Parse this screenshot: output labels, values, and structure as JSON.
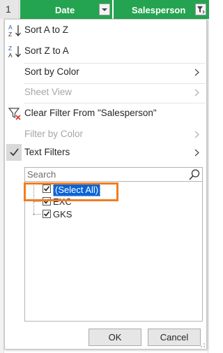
{
  "sheet": {
    "row_number": "1",
    "columns": [
      {
        "title": "Date",
        "filter_state": "dropdown"
      },
      {
        "title": "Salesperson",
        "filter_state": "filtered"
      }
    ],
    "header_color": "#24a450"
  },
  "menu": {
    "items": [
      {
        "label": "Sort A to Z",
        "icon": "sort-a-to-z-icon",
        "enabled": true
      },
      {
        "label": "Sort Z to A",
        "icon": "sort-z-to-a-icon",
        "enabled": true
      },
      {
        "label": "Sort by Color",
        "enabled": true,
        "submenu": true
      },
      {
        "label": "Sheet View",
        "enabled": false,
        "submenu": true
      },
      {
        "label": "Clear Filter From \"Salesperson\"",
        "icon": "clear-filter-icon",
        "enabled": true
      },
      {
        "label": "Filter by Color",
        "enabled": false,
        "submenu": true
      },
      {
        "label": "Text Filters",
        "enabled": true,
        "submenu": true,
        "checked": true
      }
    ],
    "search": {
      "placeholder": "Search",
      "value": ""
    },
    "tree": [
      {
        "label": "(Select All)",
        "checked": true,
        "selected": true
      },
      {
        "label": "EXC",
        "checked": true
      },
      {
        "label": "GKS",
        "checked": true
      }
    ],
    "ok_label": "OK",
    "cancel_label": "Cancel"
  },
  "accent_colors": {
    "highlight": "#f07d22",
    "selection": "#0a64d6"
  }
}
